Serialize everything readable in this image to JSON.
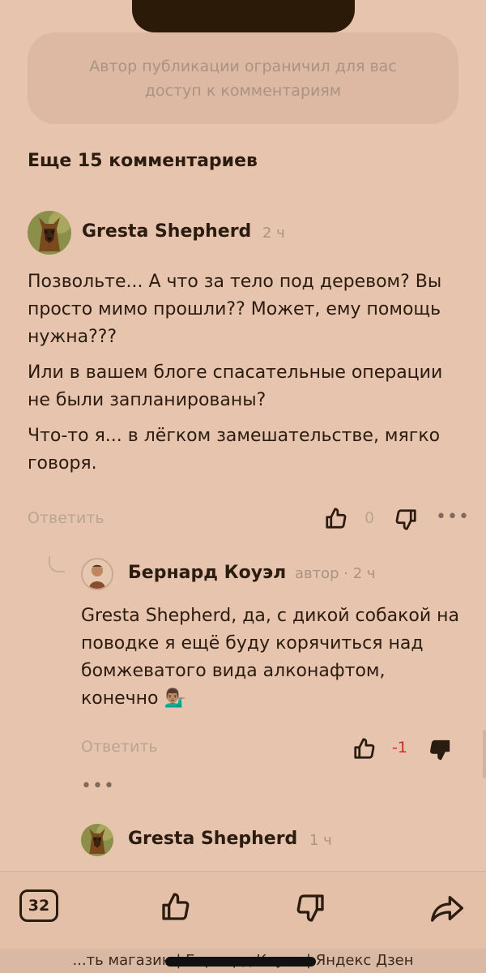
{
  "restriction_notice": "Автор публикации ограничил для вас доступ к комментариям",
  "more_comments": "Еще 15 комментариев",
  "comments": [
    {
      "author": "Gresta Shepherd",
      "time": "2 ч",
      "paragraphs": [
        "Позвольте... А что за тело под деревом? Вы просто мимо прошли?? Может, ему помощь нужна???",
        "Или в вашем блоге спасательные операции не были запланированы?",
        "Что-то я... в лёгком замешательстве, мягко говоря."
      ],
      "reply_label": "Ответить",
      "like_count": "0"
    }
  ],
  "reply": {
    "author": "Бернард Коуэл",
    "meta": "автор · 2 ч",
    "text": "Gresta Shepherd, да, с дикой собакой на поводке я ещё буду корячиться над бомжеватого вида алконафтом, конечно 💁🏽‍♂️",
    "reply_label": "Ответить",
    "like_count": "-1"
  },
  "next_comment": {
    "author": "Gresta Shepherd",
    "time": "1 ч"
  },
  "bottom_bar": {
    "comment_count": "32"
  },
  "url_bar": {
    "text": "...ть магазин | Бернард Коуэл | Яндекс Дзен"
  },
  "icons": {
    "like": "thumbs-up-icon",
    "dislike": "thumbs-down-icon",
    "more": "more-dots-icon",
    "share": "share-arrow-icon"
  },
  "colors": {
    "background": "#e7c4ad",
    "text": "#2b1c10",
    "muted": "#a99382",
    "negative": "#d9271d"
  }
}
